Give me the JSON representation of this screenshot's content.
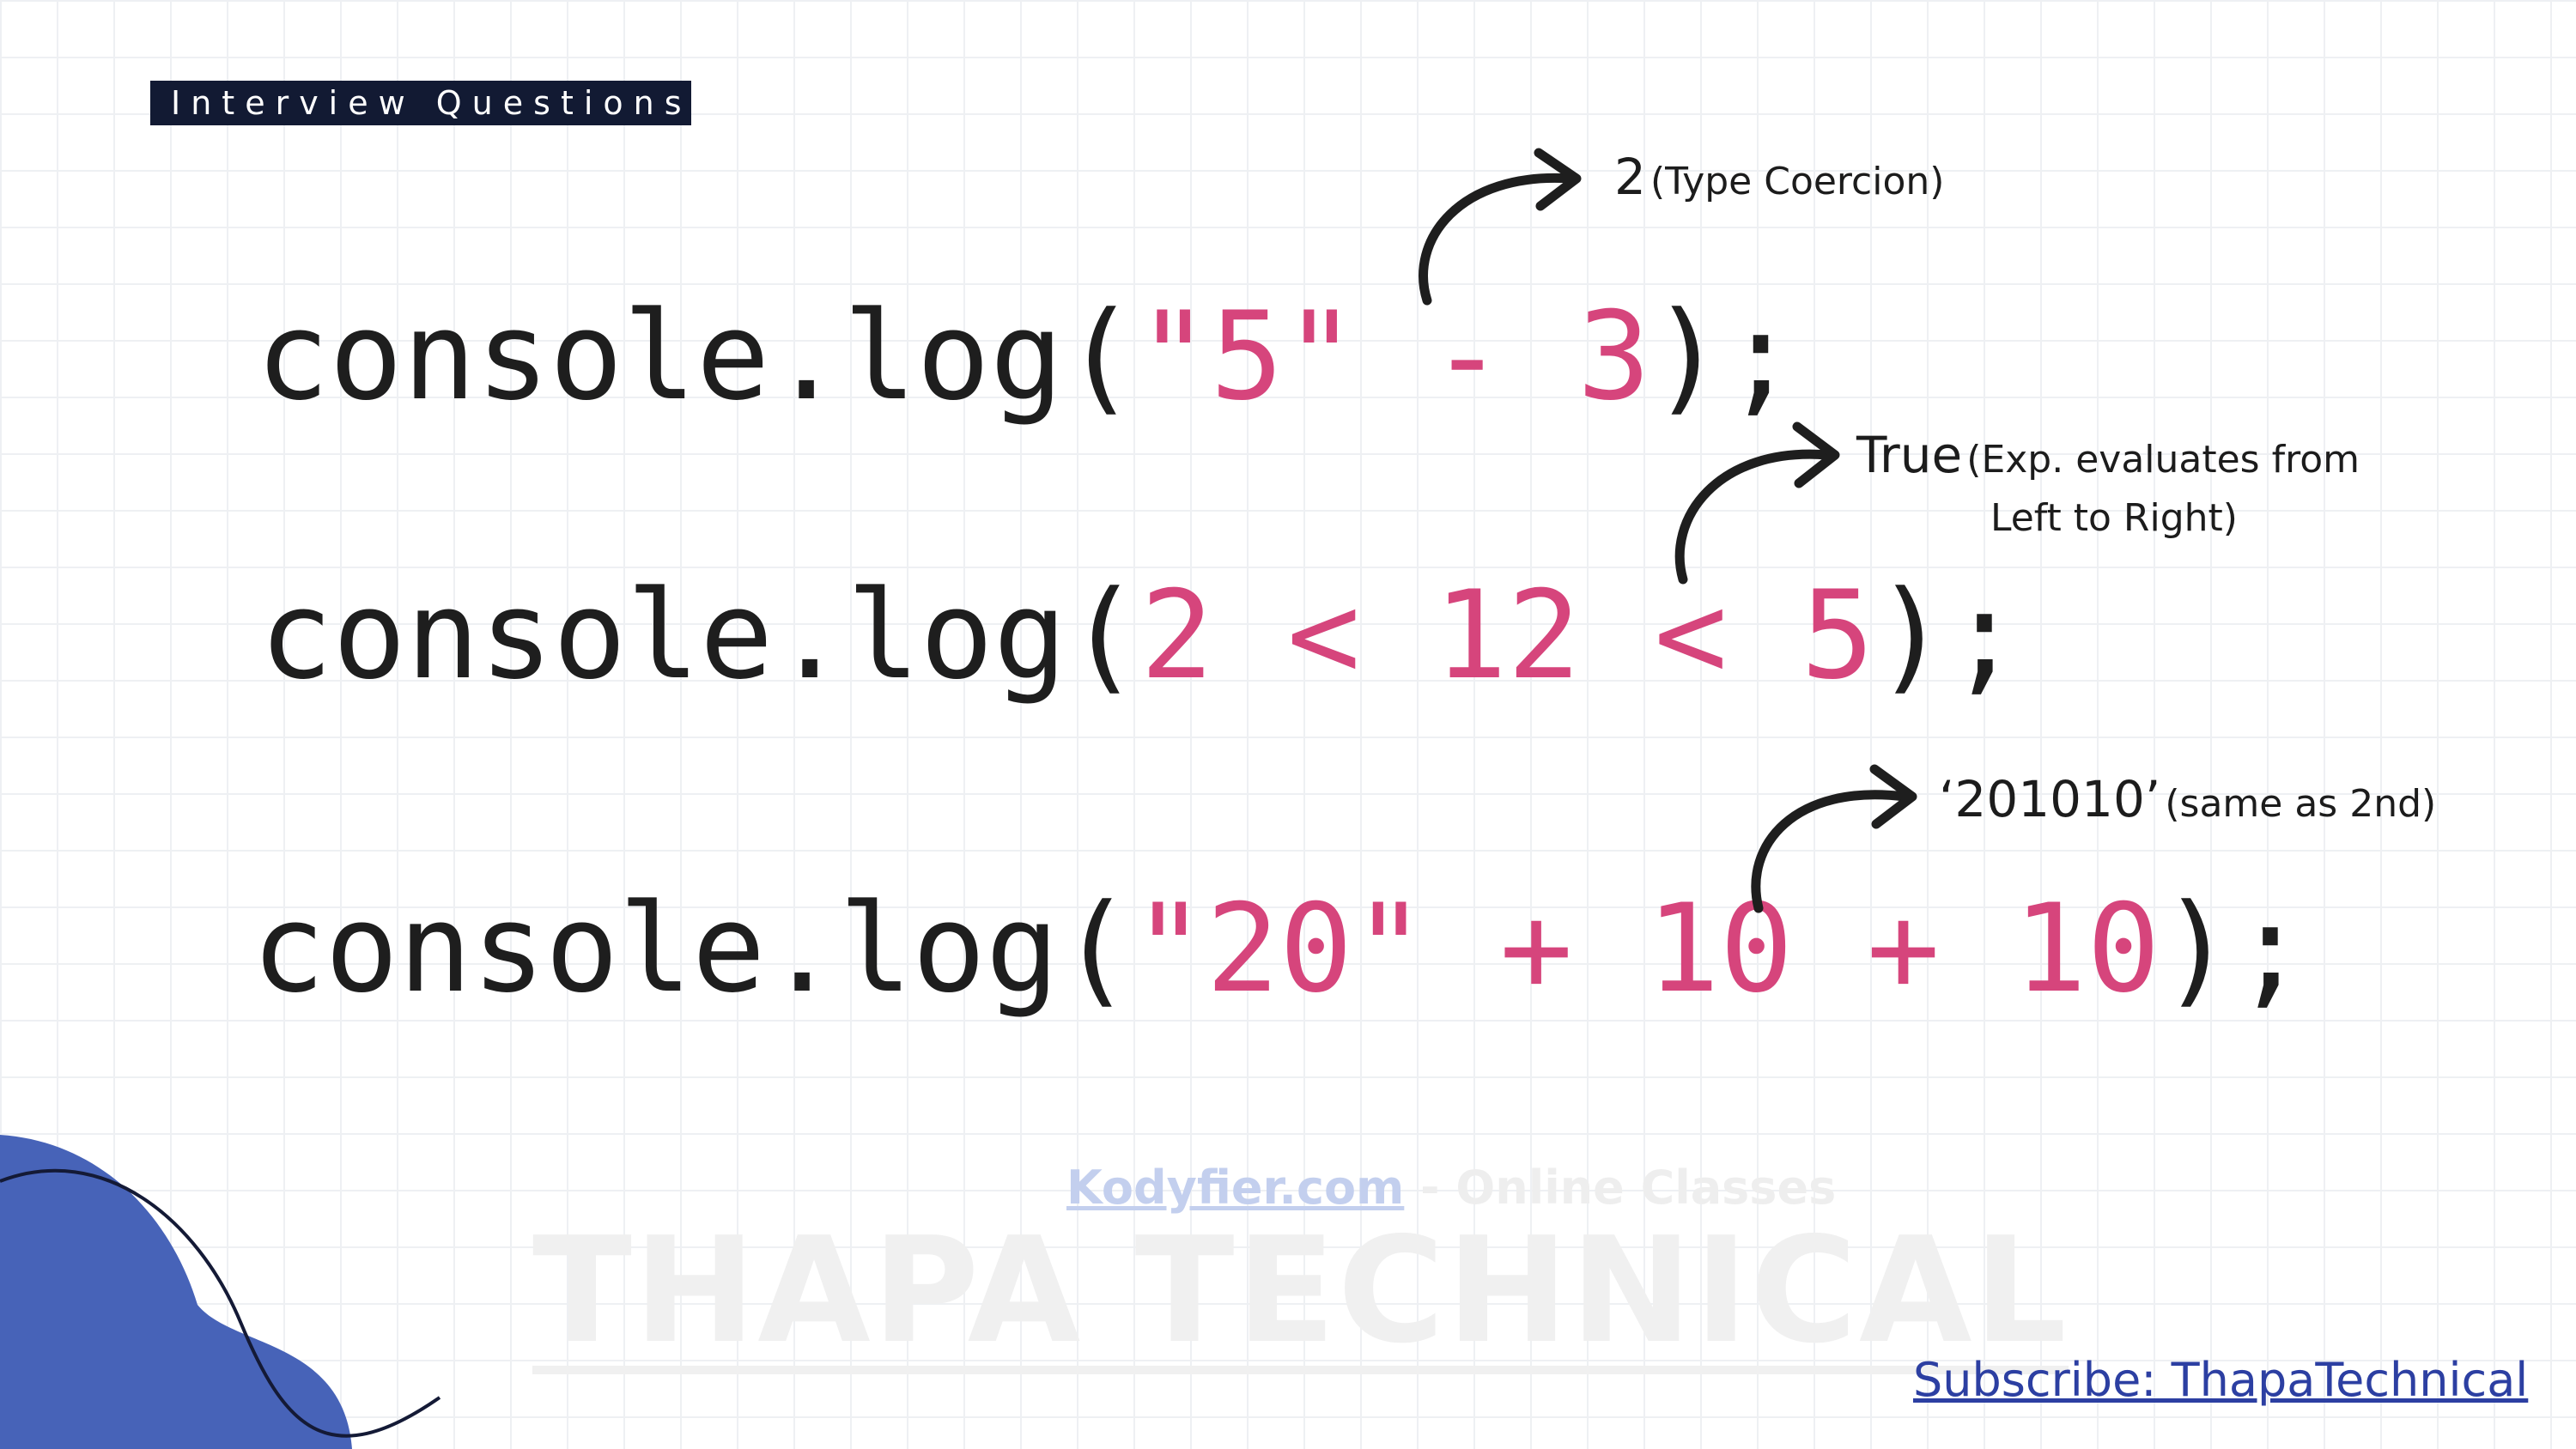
{
  "badge": {
    "label": "Interview Questions"
  },
  "questions": [
    {
      "prefix": "console.log(",
      "expr": "\"5\" - 3",
      "suffix": ");"
    },
    {
      "prefix": "console.log(",
      "expr": "2 < 12 < 5",
      "suffix": ");"
    },
    {
      "prefix": "console.log(",
      "expr": "\"20\" + 10 + 10",
      "suffix": ");"
    }
  ],
  "answers": [
    {
      "value": "2",
      "note": "(Type Coercion)"
    },
    {
      "value": "True",
      "note": "(Exp. evaluates from",
      "note_line2": "Left to Right)"
    },
    {
      "value": "‘201010’",
      "note": "(same as 2nd)"
    }
  ],
  "watermark": {
    "site": "Kodyfier.com",
    "tagline": "- Online Classes",
    "brand": "THAPA TECHNICAL"
  },
  "subscribe": {
    "label": "Subscribe: ThapaTechnical"
  },
  "colors": {
    "accent": "#d6457c",
    "badge_bg": "#121a33",
    "blob": "#4763b8",
    "link": "#2c3fa2"
  }
}
